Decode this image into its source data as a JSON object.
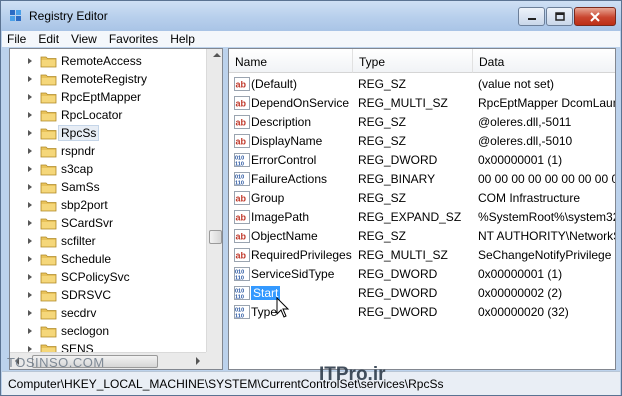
{
  "window": {
    "title": "Registry Editor",
    "controls": {
      "minimize": "minimize-icon",
      "maximize": "maximize-icon",
      "close": "close-icon"
    }
  },
  "menu": [
    "File",
    "Edit",
    "View",
    "Favorites",
    "Help"
  ],
  "tree": {
    "items": [
      {
        "label": "RemoteAccess"
      },
      {
        "label": "RemoteRegistry"
      },
      {
        "label": "RpcEptMapper"
      },
      {
        "label": "RpcLocator"
      },
      {
        "label": "RpcSs",
        "selected": true
      },
      {
        "label": "rspndr"
      },
      {
        "label": "s3cap"
      },
      {
        "label": "SamSs"
      },
      {
        "label": "sbp2port"
      },
      {
        "label": "SCardSvr"
      },
      {
        "label": "scfilter"
      },
      {
        "label": "Schedule"
      },
      {
        "label": "SCPolicySvc"
      },
      {
        "label": "SDRSVC"
      },
      {
        "label": "secdrv"
      },
      {
        "label": "seclogon"
      },
      {
        "label": "SENS"
      }
    ]
  },
  "list": {
    "columns": {
      "name": "Name",
      "type": "Type",
      "data": "Data"
    },
    "rows": [
      {
        "icon": "string-value-icon",
        "name": "(Default)",
        "type": "REG_SZ",
        "data": "(value not set)"
      },
      {
        "icon": "string-value-icon",
        "name": "DependOnService",
        "type": "REG_MULTI_SZ",
        "data": "RpcEptMapper DcomLaun"
      },
      {
        "icon": "string-value-icon",
        "name": "Description",
        "type": "REG_SZ",
        "data": "@oleres.dll,-5011"
      },
      {
        "icon": "string-value-icon",
        "name": "DisplayName",
        "type": "REG_SZ",
        "data": "@oleres.dll,-5010"
      },
      {
        "icon": "binary-value-icon",
        "name": "ErrorControl",
        "type": "REG_DWORD",
        "data": "0x00000001 (1)"
      },
      {
        "icon": "binary-value-icon",
        "name": "FailureActions",
        "type": "REG_BINARY",
        "data": "00 00 00 00 00 00 00 00 00 0"
      },
      {
        "icon": "string-value-icon",
        "name": "Group",
        "type": "REG_SZ",
        "data": "COM Infrastructure"
      },
      {
        "icon": "string-value-icon",
        "name": "ImagePath",
        "type": "REG_EXPAND_SZ",
        "data": "%SystemRoot%\\system32"
      },
      {
        "icon": "string-value-icon",
        "name": "ObjectName",
        "type": "REG_SZ",
        "data": "NT AUTHORITY\\NetworkS"
      },
      {
        "icon": "string-value-icon",
        "name": "RequiredPrivileges",
        "type": "REG_MULTI_SZ",
        "data": "SeChangeNotifyPrivilege S"
      },
      {
        "icon": "binary-value-icon",
        "name": "ServiceSidType",
        "type": "REG_DWORD",
        "data": "0x00000001 (1)"
      },
      {
        "icon": "binary-value-icon",
        "name": "Start",
        "type": "REG_DWORD",
        "data": "0x00000002 (2)",
        "selected": true
      },
      {
        "icon": "binary-value-icon",
        "name": "Type",
        "type": "REG_DWORD",
        "data": "0x00000020 (32)"
      }
    ]
  },
  "statusbar": {
    "path": "Computer\\HKEY_LOCAL_MACHINE\\SYSTEM\\CurrentControlSet\\services\\RpcSs"
  },
  "watermarks": {
    "left": "TOSINSO.COM",
    "right": "ITPro.ir"
  },
  "colors": {
    "selection": "#3399ff",
    "folder": "#e8c25a",
    "string_icon": "#c0392b",
    "binary_icon": "#1f4e9c"
  }
}
